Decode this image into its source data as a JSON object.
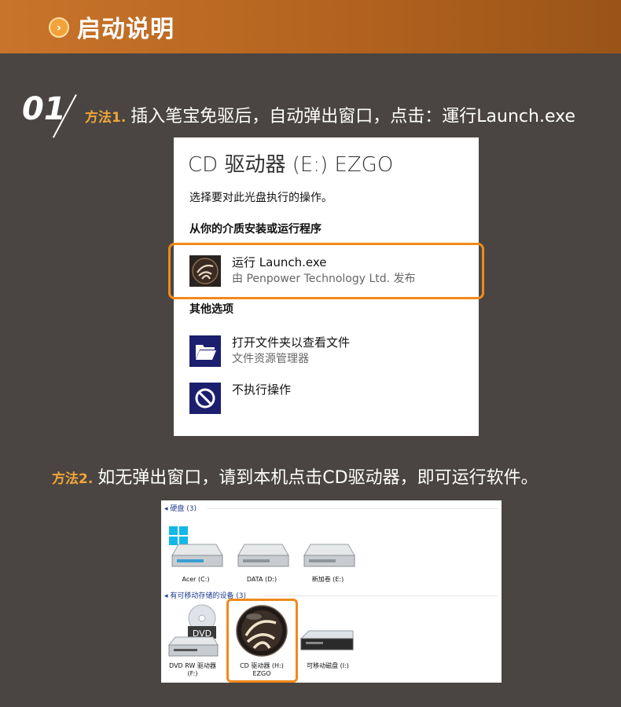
{
  "header": {
    "icon": "chevron-right-icon",
    "title": "启动说明"
  },
  "step": {
    "number": "01"
  },
  "method1": {
    "tag": "方法1.",
    "text": "插入笔宝免驱后，自动弹出窗口，点击：運行Launch.exe"
  },
  "dialog": {
    "title": "CD 驱动器 (E:) EZGO",
    "prompt": "选择要对此光盘执行的操作。",
    "section_install": "从你的介质安装或运行程序",
    "option_run": {
      "line1": "运行 Launch.exe",
      "line2": "由 Penpower Technology Ltd. 发布",
      "icon": "ezgo-app-icon"
    },
    "section_other": "其他选项",
    "option_open": {
      "line1": "打开文件夹以查看文件",
      "line2": "文件资源管理器",
      "icon": "folder-icon"
    },
    "option_none": {
      "line1": "不执行操作",
      "icon": "no-action-icon"
    },
    "accent": "#f08a1c"
  },
  "method2": {
    "tag": "方法2.",
    "text": "如无弹出窗口，请到本机点击CD驱动器，即可运行软件。"
  },
  "explorer": {
    "group_hdd": "硬盘 (3)",
    "group_removable": "有可移动存储的设备 (3)",
    "drives_hdd": [
      {
        "label": "Acer (C:)",
        "icon": "windows-drive-icon"
      },
      {
        "label": "DATA (D:)",
        "icon": "hard-drive-icon"
      },
      {
        "label": "新加卷 (E:)",
        "icon": "hard-drive-icon"
      }
    ],
    "drives_removable": [
      {
        "label": "DVD RW 驱动器\n(F:)",
        "icon": "dvd-drive-icon"
      },
      {
        "label": "CD 驱动器 (H:)\nEZGO",
        "icon": "ezgo-cd-icon"
      },
      {
        "label": "可移动磁盘 (I:)",
        "icon": "removable-disk-icon"
      }
    ]
  }
}
